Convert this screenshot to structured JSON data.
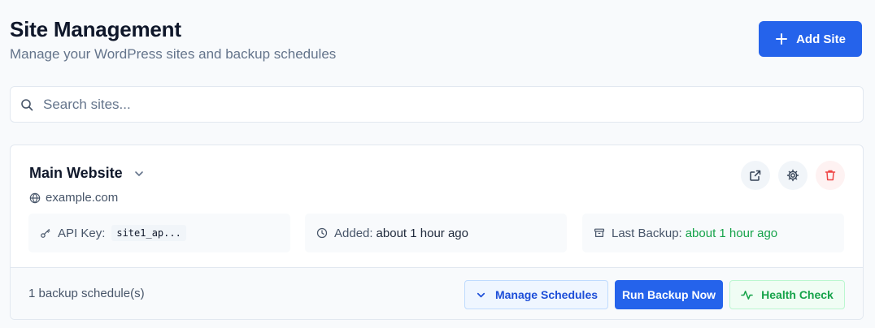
{
  "header": {
    "title": "Site Management",
    "subtitle": "Manage your WordPress sites and backup schedules",
    "add_button_label": "Add Site"
  },
  "search": {
    "placeholder": "Search sites...",
    "value": ""
  },
  "site": {
    "name": "Main Website",
    "url": "example.com",
    "api_key_label": "API Key:",
    "api_key_value": "site1_ap...",
    "added_label": "Added:",
    "added_value": "about 1 hour ago",
    "last_backup_label": "Last Backup:",
    "last_backup_value": "about 1 hour ago",
    "schedule_count": "1 backup schedule(s)",
    "manage_schedules_label": "Manage Schedules",
    "run_backup_label": "Run Backup Now",
    "health_check_label": "Health Check"
  },
  "icons": {
    "add": "plus-icon",
    "search": "search-icon",
    "expand": "chevron-down-icon",
    "url": "globe-icon",
    "open": "external-link-icon",
    "settings": "gear-icon",
    "delete": "trash-icon",
    "api_key": "key-icon",
    "added": "clock-icon",
    "backup": "archive-icon",
    "schedules": "chevron-down-icon",
    "health": "activity-icon"
  },
  "colors": {
    "primary": "#2563eb",
    "success": "#16a34a",
    "danger": "#ef4444",
    "text": "#0f172a",
    "muted": "#64748b"
  }
}
